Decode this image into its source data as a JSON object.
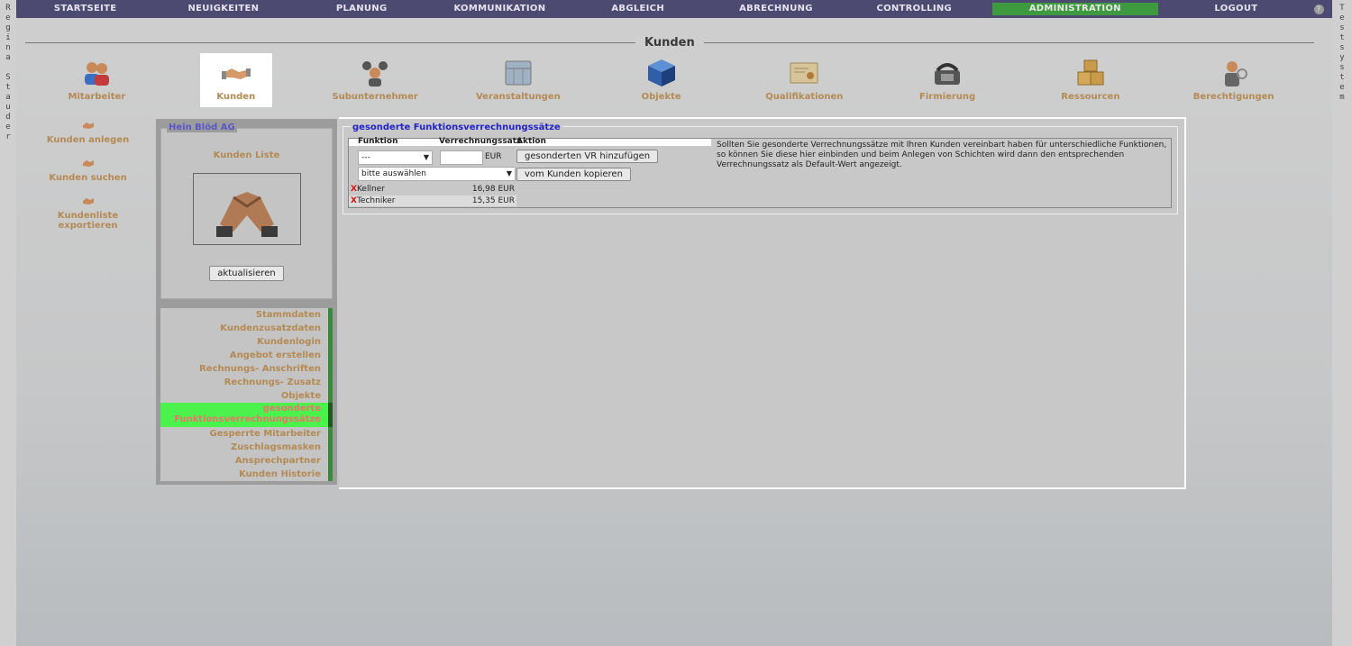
{
  "left_strip": [
    "R",
    "e",
    "g",
    "i",
    "n",
    "a",
    " ",
    "S",
    "t",
    "a",
    "u",
    "d",
    "e",
    "r"
  ],
  "right_strip": [
    "T",
    "e",
    "s",
    "t",
    "s",
    "y",
    "s",
    "t",
    "e",
    "m"
  ],
  "nav": {
    "items": [
      "STARTSEITE",
      "NEUIGKEITEN",
      "PLANUNG",
      "KOMMUNIKATION",
      "ABGLEICH",
      "ABRECHNUNG",
      "CONTROLLING",
      "ADMINISTRATION",
      "LOGOUT"
    ],
    "help": "?"
  },
  "page_title": "Kunden",
  "modules": [
    {
      "label": "Mitarbeiter",
      "icon": "users-icon"
    },
    {
      "label": "Kunden",
      "icon": "handshake-icon"
    },
    {
      "label": "Subunternehmer",
      "icon": "subcontractor-icon"
    },
    {
      "label": "Veranstaltungen",
      "icon": "calendar-icon"
    },
    {
      "label": "Objekte",
      "icon": "cube-icon"
    },
    {
      "label": "Qualifikationen",
      "icon": "certificate-icon"
    },
    {
      "label": "Firmierung",
      "icon": "phone-icon"
    },
    {
      "label": "Ressourcen",
      "icon": "boxes-icon"
    },
    {
      "label": "Berechtigungen",
      "icon": "admin-user-icon"
    }
  ],
  "actions": [
    "Kunden anlegen",
    "Kunden suchen",
    "Kundenliste exportieren"
  ],
  "customer": {
    "name": "Hein Blöd AG",
    "list_label": "Kunden Liste",
    "refresh_label": "aktualisieren"
  },
  "menu": [
    "Stammdaten",
    "Kundenzusatzdaten",
    "Kundenlogin",
    "Angebot erstellen",
    "Rechnungs- Anschriften",
    "Rechnungs- Zusatz",
    "Objekte",
    "gesonderte Funktionsverrechnungssätze",
    "Gesperrte Mitarbeiter",
    "Zuschlagsmasken",
    "Ansprechpartner",
    "Kunden Historie"
  ],
  "fvr": {
    "title": "gesonderte Funktionsverrechnungssätze",
    "col_function": "Funktion",
    "col_rate": "Verrechnungssatz",
    "col_action": "Aktion",
    "function_select": "---",
    "rate_value": "",
    "currency": "EUR",
    "add_button": "gesonderten VR hinzufügen",
    "copy_select": "bitte auswählen",
    "copy_button": "vom Kunden kopieren",
    "delete_symbol": "X",
    "rows": [
      {
        "name": "Kellner",
        "rate": "16,98 EUR"
      },
      {
        "name": "Techniker",
        "rate": "15,35 EUR"
      }
    ],
    "info_text": "Sollten Sie gesonderte Verrechnungssätze mit Ihren Kunden vereinbart haben für unterschiedliche Funktionen, so können Sie diese hier einbinden und beim Anlegen von Schichten wird dann den entsprechenden Verrechnungssatz als Default-Wert angezeigt."
  },
  "colors": {
    "nav_bg": "#4d4a72",
    "active_nav": "#3e9a3e",
    "active_menu": "#4cf24c",
    "label": "#b48a54",
    "legend": "#2222cc"
  }
}
